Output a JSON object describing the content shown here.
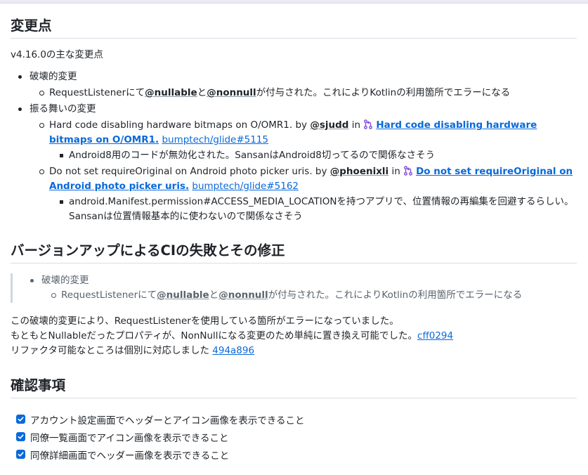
{
  "section_changes": {
    "title": "変更点",
    "intro": "v4.16.0の主な変更点",
    "item1": {
      "label": "破壊的変更",
      "sub": {
        "text_before": "RequestListenerにて",
        "mention1": "@nullable",
        "text_mid": "と",
        "mention2": "@nonnull",
        "text_after": "が付与された。これによりKotlinの利用箇所でエラーになる"
      }
    },
    "item2": {
      "label": "振る舞いの変更",
      "sub1": {
        "text": "Hard code disabling hardware bitmaps on O/OMR1. by ",
        "author": "@sjudd",
        "in_text": " in ",
        "pr_title": "Hard code disabling hardware bitmaps on O/OMR1.",
        "pr_ref": "bumptech/glide#5115",
        "note": "Android8用のコードが無効化された。SansanはAndroid8切ってるので関係なさそう"
      },
      "sub2": {
        "text": "Do not set requireOriginal on Android photo picker uris. by ",
        "author": "@phoenixli",
        "in_text": " in ",
        "pr_title": "Do not set requireOriginal on Android photo picker uris.",
        "pr_ref": "bumptech/glide#5162",
        "note": "android.Manifest.permission#ACCESS_MEDIA_LOCATIONを持つアプリで、位置情報の再編集を回避するらしい。Sansanは位置情報基本的に使わないので関係なさそう"
      }
    }
  },
  "section_ci": {
    "title": "バージョンアップによるCIの失敗とその修正",
    "quote": {
      "label": "破壊的変更",
      "text_before": "RequestListenerにて",
      "mention1": "@nullable",
      "text_mid": "と",
      "mention2": "@nonnull",
      "text_after": "が付与された。これによりKotlinの利用箇所でエラーになる"
    },
    "line1": "この破壊的変更により、RequestListenerを使用している箇所がエラーになっていました。",
    "line2": "もともとNullableだったプロパティが、NonNullになる変更のため単純に置き換え可能でした。",
    "commit1": "cff0294",
    "line3": "リファクタ可能なところは個別に対応しました ",
    "commit2": "494a896"
  },
  "section_check": {
    "title": "確認事項",
    "tasks": [
      "アカウント設定画面でヘッダーとアイコン画像を表示できること",
      "同僚一覧画面でアイコン画像を表示できること",
      "同僚詳細画面でヘッダー画像を表示できること"
    ]
  },
  "colors": {
    "link": "#0969da",
    "text": "#1f2328",
    "muted": "#59636e",
    "pr_icon": "#8250df",
    "checkbox": "#0969da"
  }
}
